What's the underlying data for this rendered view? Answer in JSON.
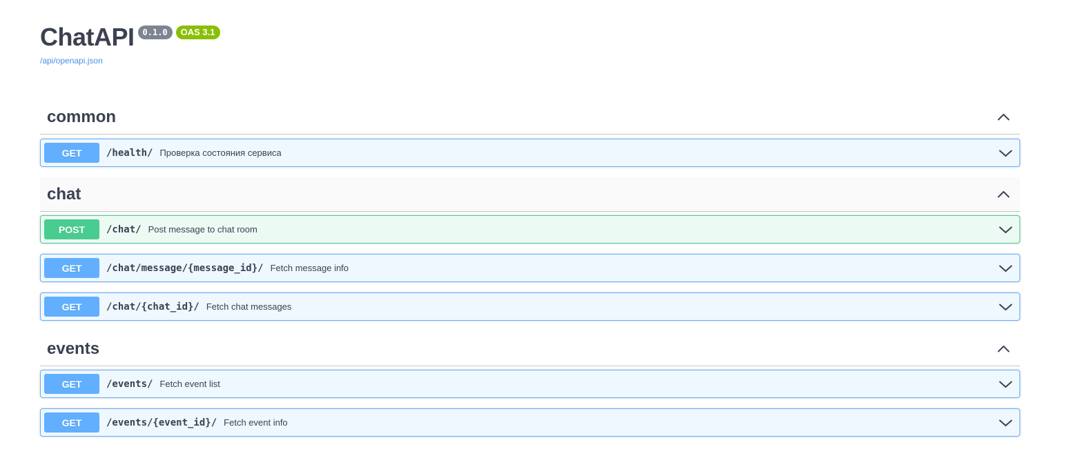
{
  "header": {
    "title": "ChatAPI",
    "version_badge": "0.1.0",
    "oas_badge": "OAS 3.1",
    "spec_link": "/api/openapi.json"
  },
  "tags": [
    {
      "name": "common",
      "operations": [
        {
          "method": "GET",
          "path": "/health/",
          "summary": "Проверка состояния сервиса"
        }
      ]
    },
    {
      "name": "chat",
      "operations": [
        {
          "method": "POST",
          "path": "/chat/",
          "summary": "Post message to chat room"
        },
        {
          "method": "GET",
          "path": "/chat/message/{message_id}/",
          "summary": "Fetch message info"
        },
        {
          "method": "GET",
          "path": "/chat/{chat_id}/",
          "summary": "Fetch chat messages"
        }
      ]
    },
    {
      "name": "events",
      "operations": [
        {
          "method": "GET",
          "path": "/events/",
          "summary": "Fetch event list"
        },
        {
          "method": "GET",
          "path": "/events/{event_id}/",
          "summary": "Fetch event info"
        }
      ]
    }
  ],
  "colors": {
    "get": "#61affe",
    "post": "#49cc90",
    "text": "#3b4151",
    "link": "#4990e2",
    "oas_badge": "#89bf04",
    "version_badge": "#7d8492"
  },
  "icons": {
    "tag_toggle": "chevron-up-icon",
    "operation_toggle": "chevron-down-icon"
  }
}
